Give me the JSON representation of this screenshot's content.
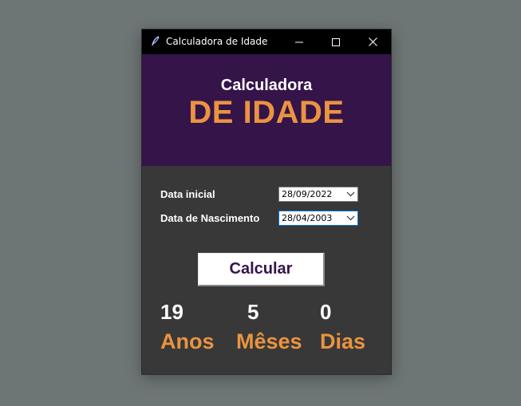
{
  "window": {
    "title": "Calculadora de Idade",
    "icons": {
      "app": "feather-icon",
      "minimize": "minimize-icon",
      "maximize": "maximize-icon",
      "close": "close-icon"
    }
  },
  "header": {
    "subtitle": "Calculadora",
    "title": "DE IDADE"
  },
  "form": {
    "start_date_label": "Data inicial",
    "start_date_value": "28/09/2022",
    "birth_date_label": "Data de Nascimento",
    "birth_date_value": "28/04/2003"
  },
  "actions": {
    "calculate_label": "Calcular"
  },
  "result": {
    "years_value": "19",
    "years_label": "Anos",
    "months_value": "5",
    "months_label": "Mêses",
    "days_value": "0",
    "days_label": "Dias"
  },
  "colors": {
    "header_bg": "#35144a",
    "accent": "#ea9440",
    "body_bg": "#383838",
    "titlebar_bg": "#000000"
  }
}
